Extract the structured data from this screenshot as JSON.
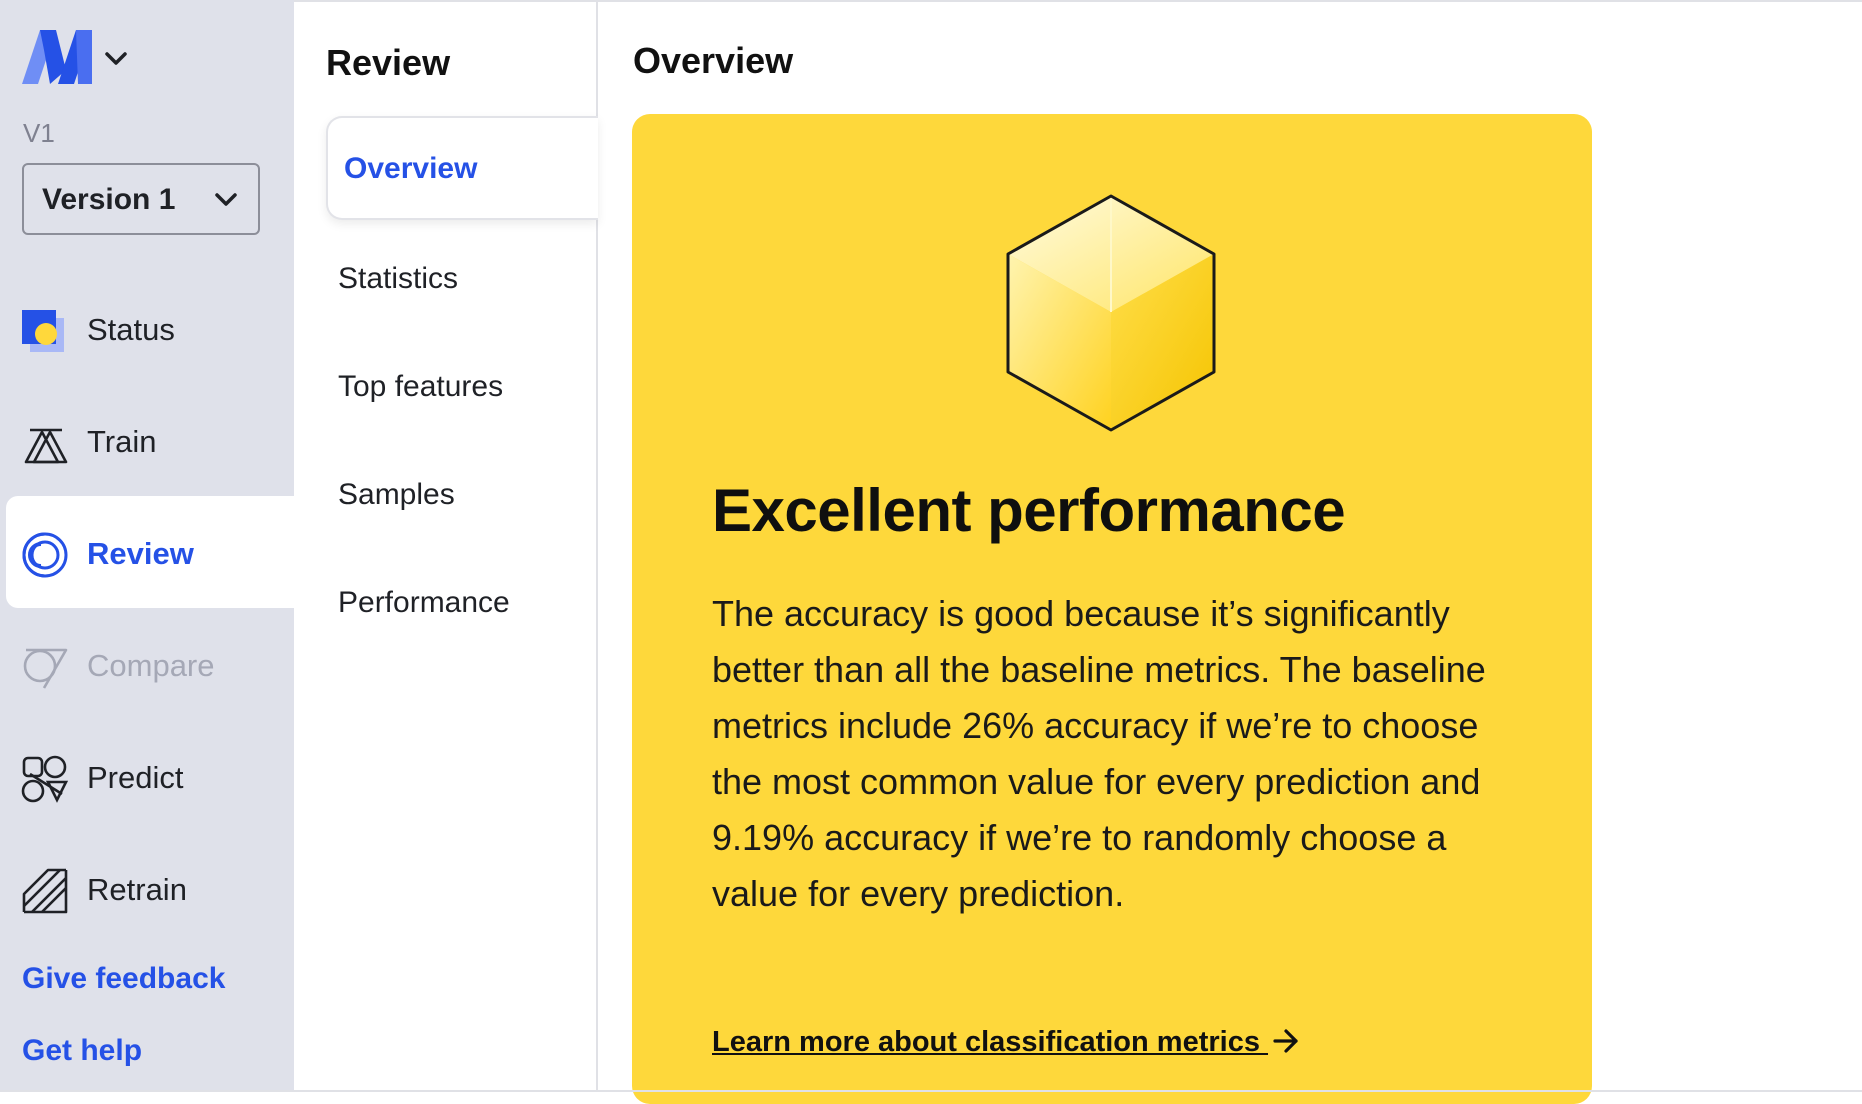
{
  "sidebar": {
    "version_caption": "V1",
    "version_select": "Version 1",
    "items": [
      {
        "label": "Status",
        "icon": "status-icon",
        "state": "normal"
      },
      {
        "label": "Train",
        "icon": "train-icon",
        "state": "normal"
      },
      {
        "label": "Review",
        "icon": "review-icon",
        "state": "active"
      },
      {
        "label": "Compare",
        "icon": "compare-icon",
        "state": "disabled"
      },
      {
        "label": "Predict",
        "icon": "predict-icon",
        "state": "normal"
      },
      {
        "label": "Retrain",
        "icon": "retrain-icon",
        "state": "normal"
      }
    ],
    "give_feedback": "Give feedback",
    "get_help": "Get help"
  },
  "subnav": {
    "title": "Review",
    "items": [
      {
        "label": "Overview",
        "active": true
      },
      {
        "label": "Statistics",
        "active": false
      },
      {
        "label": "Top features",
        "active": false
      },
      {
        "label": "Samples",
        "active": false
      },
      {
        "label": "Performance",
        "active": false
      }
    ]
  },
  "main": {
    "title": "Overview",
    "card": {
      "icon": "cube-icon",
      "heading": "Excellent performance",
      "body": "The accuracy is good because it’s significantly better than all the baseline metrics. The baseline metrics include 26% accuracy if we’re to choose the most common value for every prediction and 9.19% accuracy if we’re to randomly choose a value for every prediction.",
      "link": "Learn more about classification metrics "
    }
  },
  "colors": {
    "accent": "#2551e6",
    "sidebar_bg": "#dfe1ea",
    "card_bg": "#fed83b"
  }
}
